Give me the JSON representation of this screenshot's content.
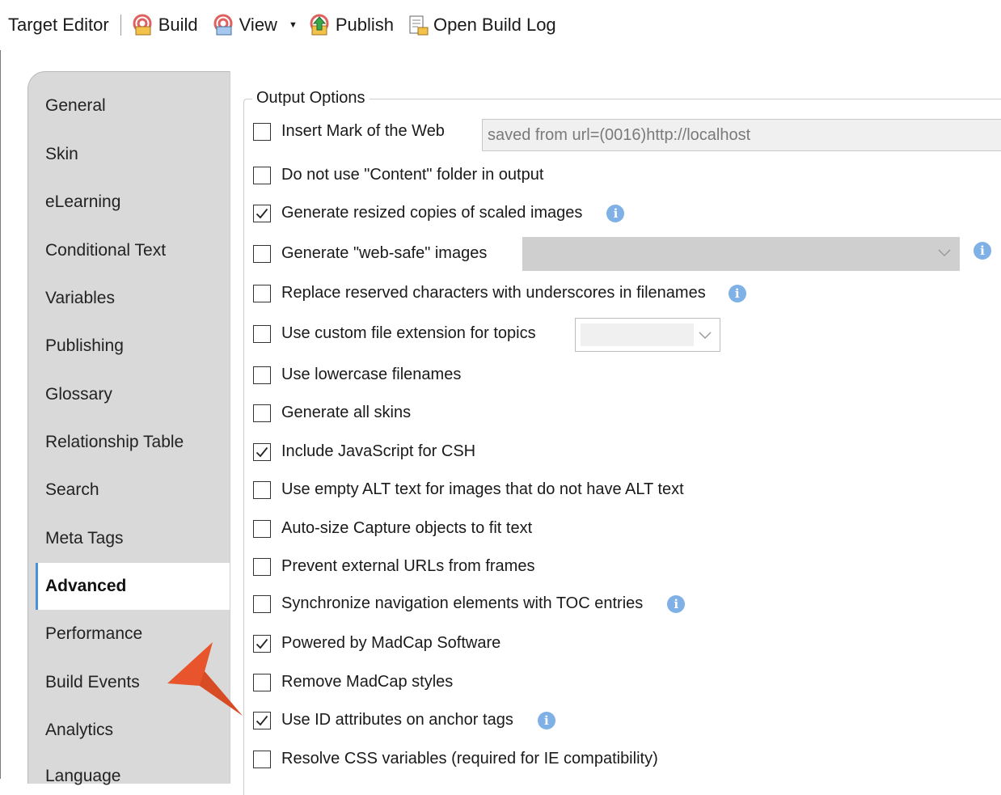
{
  "toolbar": {
    "title": "Target Editor",
    "build": "Build",
    "view": "View",
    "publish": "Publish",
    "open_build_log": "Open Build Log"
  },
  "tabs": [
    "General",
    "Skin",
    "eLearning",
    "Conditional Text",
    "Variables",
    "Publishing",
    "Glossary",
    "Relationship Table",
    "Search",
    "Meta Tags",
    "Advanced",
    "Performance",
    "Build Events",
    "Analytics",
    "Language"
  ],
  "active_tab": "Advanced",
  "output_options": {
    "legend": "Output Options",
    "mark_of_web_value": "saved from url=(0016)http://localhost",
    "options": [
      {
        "label": "Insert Mark of the Web",
        "checked": false
      },
      {
        "label": "Do not use \"Content\" folder in output",
        "checked": false
      },
      {
        "label": "Generate resized copies of scaled images",
        "checked": true
      },
      {
        "label": "Generate \"web-safe\" images",
        "checked": false
      },
      {
        "label": "Replace reserved characters with underscores in filenames",
        "checked": false
      },
      {
        "label": "Use custom file extension for topics",
        "checked": false
      },
      {
        "label": "Use lowercase filenames",
        "checked": false
      },
      {
        "label": "Generate all skins",
        "checked": false
      },
      {
        "label": "Include JavaScript for CSH",
        "checked": true
      },
      {
        "label": "Use empty ALT text for images that do not have ALT text",
        "checked": false
      },
      {
        "label": "Auto-size Capture objects to fit text",
        "checked": false
      },
      {
        "label": "Prevent external URLs from frames",
        "checked": false
      },
      {
        "label": "Synchronize navigation elements with TOC entries",
        "checked": false
      },
      {
        "label": "Powered by MadCap Software",
        "checked": true
      },
      {
        "label": "Remove MadCap styles",
        "checked": false
      },
      {
        "label": "Use ID attributes on anchor tags",
        "checked": true
      },
      {
        "label": "Resolve CSS variables (required for IE compatibility)",
        "checked": false
      }
    ]
  },
  "colors": {
    "info_icon": "#7fb1e6",
    "callout_arrow": "#e8552c",
    "tab_strip": "#d9d9d9",
    "active_tab_border": "#4a90d9"
  },
  "icons": {
    "build": "build-icon",
    "view": "view-icon",
    "publish": "publish-icon",
    "open_build_log": "build-log-icon",
    "info": "info-icon"
  }
}
